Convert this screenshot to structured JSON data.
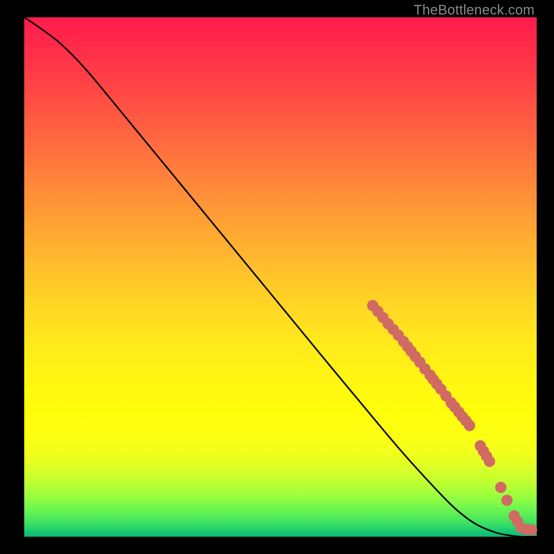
{
  "watermark": "TheBottleneck.com",
  "chart_data": {
    "type": "line",
    "title": "",
    "xlabel": "",
    "ylabel": "",
    "xlim": [
      0,
      100
    ],
    "ylim": [
      0,
      100
    ],
    "series": [
      {
        "name": "bottleneck-curve",
        "x": [
          0,
          3,
          7,
          12,
          20,
          30,
          40,
          50,
          60,
          68,
          74,
          80,
          84,
          88,
          92,
          95,
          97,
          98.5,
          100
        ],
        "y": [
          100,
          98,
          95,
          90,
          80.5,
          68.5,
          56.5,
          44.5,
          32.5,
          23,
          16,
          9.5,
          5.5,
          2.5,
          0.8,
          0.2,
          0,
          0,
          0
        ],
        "color": "#000000"
      }
    ],
    "points": {
      "name": "highlighted-range",
      "color": "#d06a62",
      "radius_pct": 1.1,
      "xy": [
        [
          68.0,
          44.5
        ],
        [
          69.0,
          43.4
        ],
        [
          70.0,
          42.2
        ],
        [
          71.0,
          41.0
        ],
        [
          72.0,
          39.9
        ],
        [
          73.0,
          38.8
        ],
        [
          74.0,
          37.6
        ],
        [
          74.8,
          36.6
        ],
        [
          75.5,
          35.7
        ],
        [
          76.3,
          34.7
        ],
        [
          77.2,
          33.6
        ],
        [
          78.2,
          32.3
        ],
        [
          79.2,
          31.1
        ],
        [
          79.8,
          30.3
        ],
        [
          80.5,
          29.4
        ],
        [
          81.3,
          28.4
        ],
        [
          82.3,
          27.1
        ],
        [
          83.3,
          25.8
        ],
        [
          84.0,
          25.0
        ],
        [
          84.8,
          24.0
        ],
        [
          85.5,
          23.1
        ],
        [
          86.2,
          22.3
        ],
        [
          86.9,
          21.4
        ],
        [
          89.0,
          17.5
        ],
        [
          89.6,
          16.5
        ],
        [
          90.2,
          15.5
        ],
        [
          90.8,
          14.5
        ],
        [
          93.0,
          9.5
        ],
        [
          94.2,
          7.0
        ],
        [
          95.6,
          4.0
        ],
        [
          96.3,
          2.9
        ],
        [
          97.0,
          1.7
        ],
        [
          98.0,
          1.4
        ],
        [
          99.0,
          1.3
        ]
      ]
    }
  }
}
